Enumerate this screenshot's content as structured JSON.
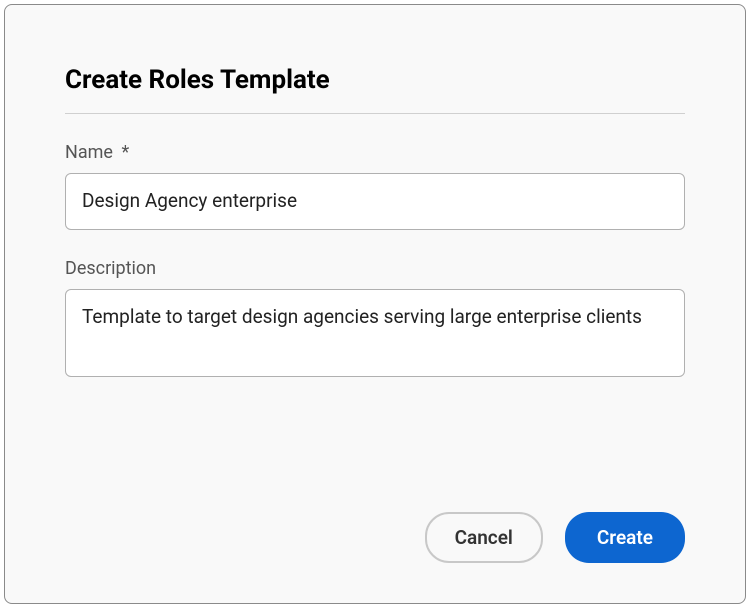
{
  "dialog": {
    "title": "Create Roles Template",
    "fields": {
      "name": {
        "label": "Name",
        "required_mark": "*",
        "value": "Design Agency enterprise"
      },
      "description": {
        "label": "Description",
        "value": "Template to target design agencies serving large enterprise clients"
      }
    },
    "buttons": {
      "cancel": "Cancel",
      "create": "Create"
    }
  }
}
